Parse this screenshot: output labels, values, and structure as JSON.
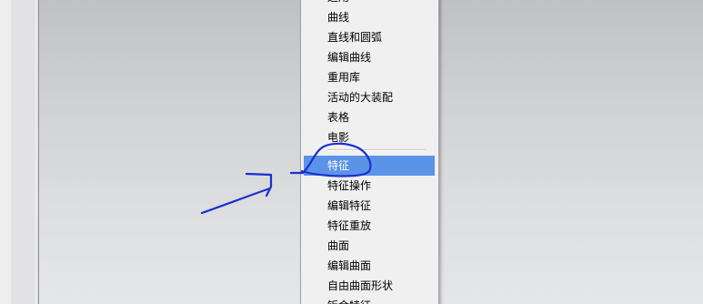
{
  "menu": {
    "items": [
      {
        "label": "运用",
        "highlighted": false
      },
      {
        "label": "曲线",
        "highlighted": false
      },
      {
        "label": "直线和圆弧",
        "highlighted": false
      },
      {
        "label": "编辑曲线",
        "highlighted": false
      },
      {
        "label": "重用库",
        "highlighted": false
      },
      {
        "label": "活动的大装配",
        "highlighted": false
      },
      {
        "label": "表格",
        "highlighted": false
      },
      {
        "label": "电影",
        "highlighted": false
      },
      {
        "label": "特征",
        "highlighted": true
      },
      {
        "label": "特征操作",
        "highlighted": false
      },
      {
        "label": "编辑特征",
        "highlighted": false
      },
      {
        "label": "特征重放",
        "highlighted": false
      },
      {
        "label": "曲面",
        "highlighted": false
      },
      {
        "label": "编辑曲面",
        "highlighted": false
      },
      {
        "label": "自由曲面形状",
        "highlighted": false
      },
      {
        "label": "钣金特征",
        "highlighted": false
      }
    ],
    "highlight_color": "#5b93e6"
  },
  "annotation": {
    "color": "#1a2fd0",
    "icons": [
      "circle-annotation-icon",
      "arrow-annotation-icon"
    ]
  }
}
